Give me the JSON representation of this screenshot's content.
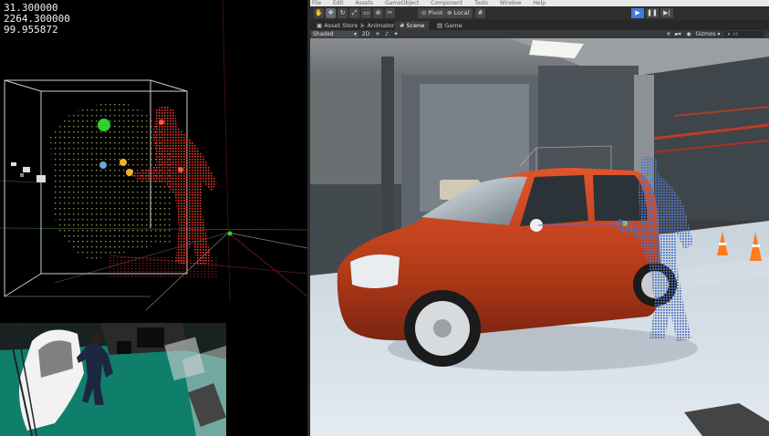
{
  "readout": {
    "line1": "31.300000",
    "line2": "2264.300000",
    "line3": "99.955872"
  },
  "editor": {
    "menu": [
      "File",
      "Edit",
      "Assets",
      "GameObject",
      "Component",
      "Tools",
      "Window",
      "Help"
    ],
    "toolbar": {
      "tools": [
        "hand-tool-icon",
        "move-tool-icon",
        "rotate-tool-icon",
        "scale-tool-icon",
        "rect-tool-icon",
        "transform-tool-icon",
        "custom-tool-icon"
      ],
      "pivot_label": "Pivot",
      "local_label": "Local",
      "play_icon": "▶",
      "pause_icon": "❚❚",
      "step_icon": "▶|"
    },
    "tabs": [
      {
        "icon": "store-icon",
        "label": "Asset Store"
      },
      {
        "icon": "animator-icon",
        "label": "Animator"
      },
      {
        "icon": "scene-icon",
        "label": "Scene"
      },
      {
        "icon": "game-icon",
        "label": "Game"
      }
    ],
    "scene_toolbar": {
      "shading_mode": "Shaded",
      "mode_2d": "2D",
      "gizmos_label": "Gizmos",
      "search_placeholder": "All"
    }
  },
  "colors": {
    "accent_play": "#3e7de0",
    "car_body": "#c8431f",
    "point_cloud_person": "#e8392a",
    "camera_floor": "#0d7a68"
  }
}
